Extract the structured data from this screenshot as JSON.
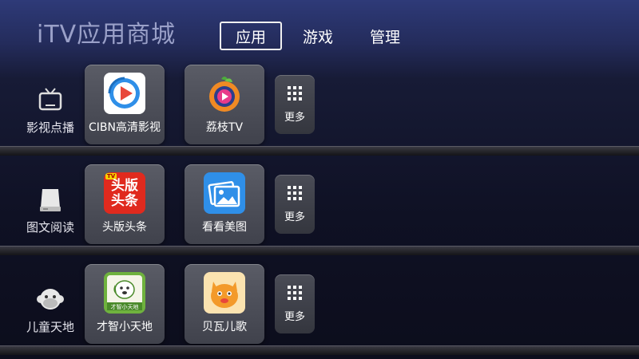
{
  "header": {
    "title": "iTV应用商城",
    "tabs": [
      {
        "label": "应用",
        "active": true
      },
      {
        "label": "游戏",
        "active": false
      },
      {
        "label": "管理",
        "active": false
      }
    ]
  },
  "rows": [
    {
      "category": {
        "label": "影视点播",
        "icon": "tv-icon"
      },
      "apps": [
        {
          "label": "CIBN高清影视",
          "icon": "cibn-play-icon"
        },
        {
          "label": "荔枝TV",
          "icon": "lychee-tv-icon"
        }
      ],
      "more_label": "更多"
    },
    {
      "category": {
        "label": "图文阅读",
        "icon": "storage-drive-icon"
      },
      "apps": [
        {
          "label": "头版头条",
          "icon": "headline-news-icon",
          "icon_text_top": "头版",
          "icon_text_bottom": "头条",
          "badge": "TV"
        },
        {
          "label": "看看美图",
          "icon": "photo-gallery-icon"
        }
      ],
      "more_label": "更多"
    },
    {
      "category": {
        "label": "儿童天地",
        "icon": "monkey-face-icon"
      },
      "apps": [
        {
          "label": "才智小天地",
          "icon": "kids-dog-icon",
          "icon_caption": "才智小天地"
        },
        {
          "label": "贝瓦儿歌",
          "icon": "beva-cat-icon"
        }
      ],
      "more_label": "更多"
    }
  ],
  "colors": {
    "accent_blue": "#2f8fe8",
    "news_red": "#e02a1e",
    "kids_green": "#6fb23e",
    "beva_orange": "#f39a2a"
  }
}
